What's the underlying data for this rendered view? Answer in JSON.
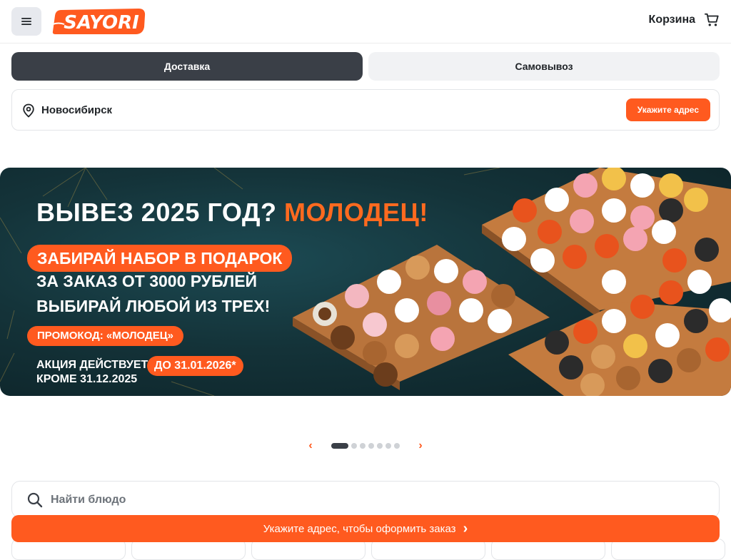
{
  "header": {
    "logo_text": "SAYORI",
    "cart_label": "Корзина"
  },
  "delivery_tabs": [
    {
      "label": "Доставка",
      "active": true
    },
    {
      "label": "Самовывоз",
      "active": false
    }
  ],
  "address": {
    "city": "Новосибирск",
    "button_label": "Укажите адрес"
  },
  "banner": {
    "headline": "ВЫВЕЗ 2025 ГОД?",
    "headline_accent": "МОЛОДЕЦ!",
    "gift_line": "ЗАБИРАЙ НАБОР В ПОДАРОК",
    "line2": "ЗА ЗАКАЗ ОТ 3000 РУБЛЕЙ",
    "line3": "ВЫБИРАЙ ЛЮБОЙ ИЗ ТРЕХ!",
    "promo": "ПРОМОКОД: «МОЛОДЕЦ»",
    "validity_prefix": "АКЦИЯ ДЕЙСТВУЕТ",
    "validity_date": "ДО 31.01.2026*",
    "exception": "КРОМЕ 31.12.2025"
  },
  "carousel": {
    "prev_icon": "‹",
    "next_icon": "›",
    "total_slides": 7,
    "active_index": 0
  },
  "search": {
    "placeholder": "Найти блюдо"
  },
  "order_bar": {
    "label": "Укажите адрес, чтобы оформить заказ",
    "icon": "›"
  },
  "colors": {
    "accent": "#ff5a1f",
    "dark": "#3a3f47",
    "banner_bg": "#143339"
  }
}
